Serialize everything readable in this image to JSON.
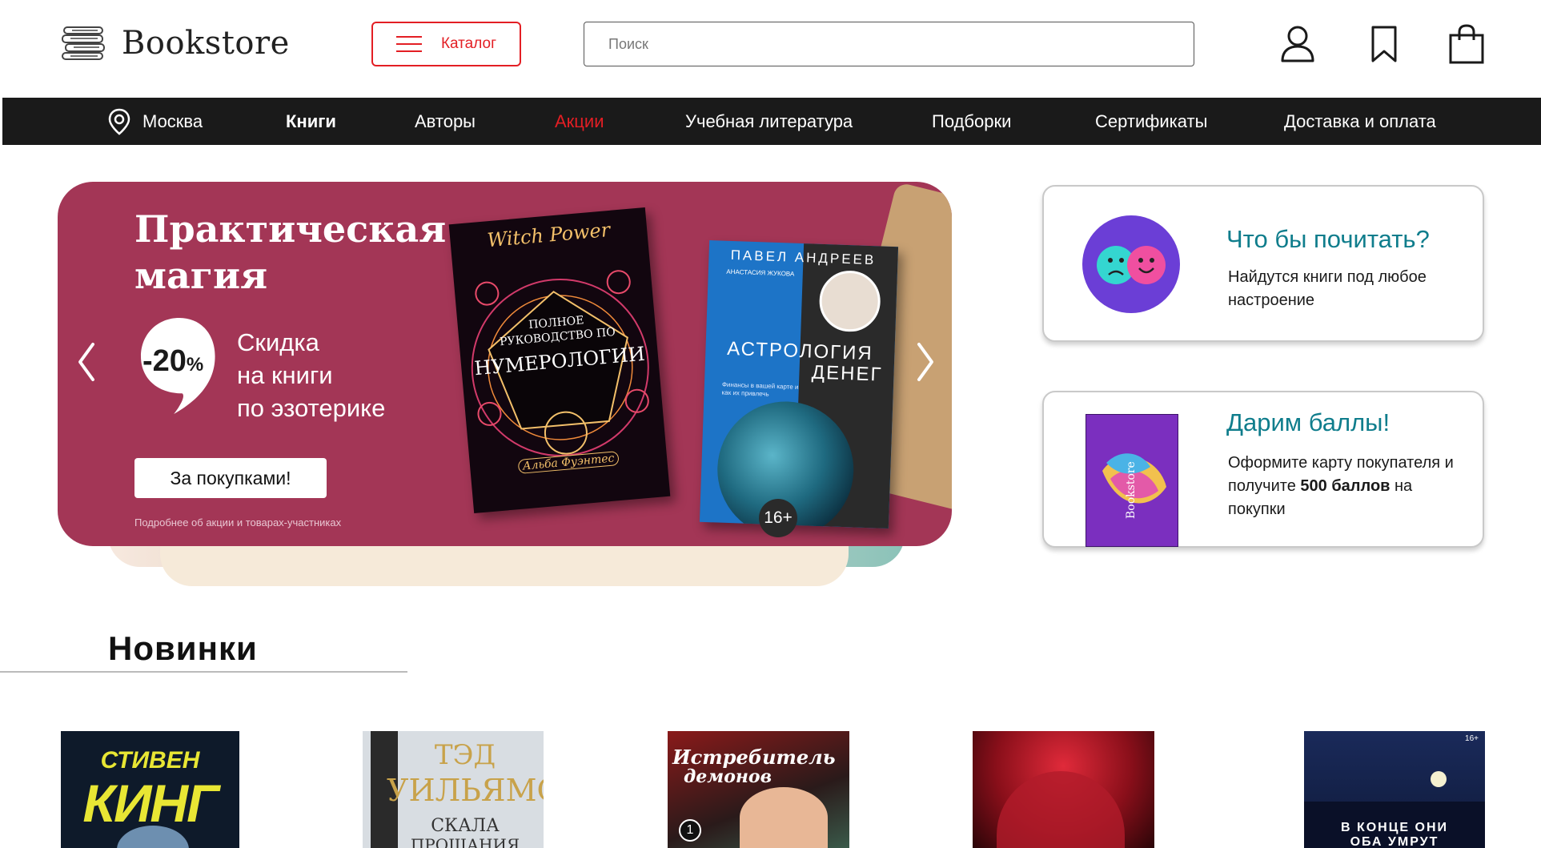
{
  "header": {
    "logo_text": "Bookstore",
    "catalog_label": "Каталог",
    "search_placeholder": "Поиск",
    "icons": [
      "user-icon",
      "bookmark-icon",
      "shopping-bag-icon"
    ]
  },
  "nav": {
    "city": "Москва",
    "items": [
      {
        "label": "Книги",
        "style": "bold"
      },
      {
        "label": "Авторы",
        "style": "normal"
      },
      {
        "label": "Акции",
        "style": "accent"
      },
      {
        "label": "Учебная литература",
        "style": "normal"
      },
      {
        "label": "Подборки",
        "style": "normal"
      },
      {
        "label": "Сертификаты",
        "style": "normal"
      },
      {
        "label": "Доставка и оплата",
        "style": "normal"
      }
    ]
  },
  "banner": {
    "title_line1": "Практическая",
    "title_line2": "магия",
    "discount": "-20",
    "discount_unit": "%",
    "sale_line1": "Скидка",
    "sale_line2": "на книги",
    "sale_line3": "по эзотерике",
    "button_label": "За покупками!",
    "details_link": "Подробнее об акции и товарах-участниках",
    "book1": {
      "top_title": "Witch Power",
      "subtitle": "ПОЛНОЕ РУКОВОДСТВО ПО",
      "title": "НУМЕРОЛОГИИ",
      "author": "Альба Фуэнтес"
    },
    "book2": {
      "author": "ПАВЕЛ АНДРЕЕВ",
      "coauthor": "АНАСТАСИЯ ЖУКОВА",
      "title_line1": "АСТРОЛОГИЯ",
      "title_line2": "ДЕНЕГ",
      "note": "Финансы в вашей карте и как их привлечь",
      "age": "16+"
    }
  },
  "cards": [
    {
      "title": "Что бы почитать?",
      "text": "Найдутся книги под любое настроение"
    },
    {
      "title": "Дарим баллы!",
      "text_before": "Оформите карту покупателя и получите ",
      "text_bold": "500 баллов",
      "text_after": " на покупки",
      "card_label": "Bookstore"
    }
  ],
  "new_releases": {
    "title": "Новинки",
    "books": [
      {
        "line1": "СТИВЕН",
        "line2": "КИНГ"
      },
      {
        "line1": "ТЭД",
        "line2": "УИЛЬЯМС",
        "line3": "СКАЛА",
        "line4": "ПРОЩАНИЯ"
      },
      {
        "line1": "Истребитель",
        "line2": "демонов",
        "badge": "1"
      },
      {},
      {
        "line1": "В КОНЦЕ ОНИ",
        "line2": "ОБА УМРУТ",
        "age": "16+"
      }
    ]
  },
  "colors": {
    "accent_red": "#e31e24",
    "nav_bg": "#1a1a1a",
    "banner_bg": "#a33656",
    "card_title": "#0f7d8c"
  }
}
